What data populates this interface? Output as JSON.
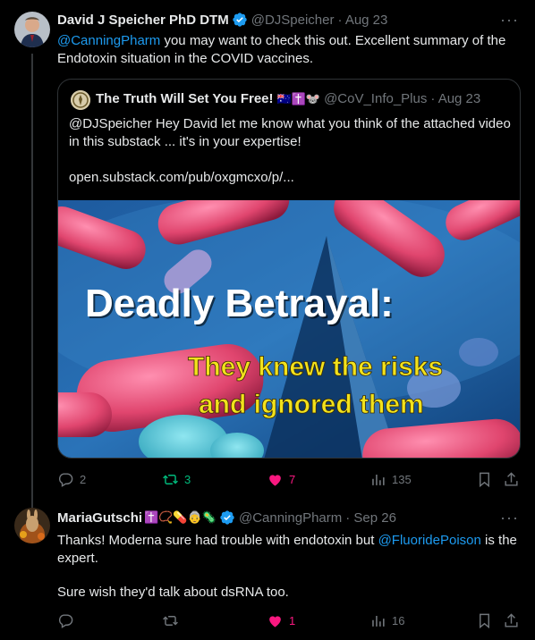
{
  "tweet1": {
    "name": "David J Speicher PhD DTM",
    "handle": "@DJSpeicher",
    "date": "· Aug 23",
    "more": "···",
    "mention": "@CanningPharm",
    "text_rest": " you may want to check this out.  Excellent summary of the Endotoxin situation in the COVID vaccines.",
    "quote": {
      "name": "The Truth Will Set You Free!",
      "emojis": "🇦🇺✝️🐭",
      "handle": "@CoV_Info_Plus",
      "date": "· Aug 23",
      "text": "@DJSpeicher Hey David let me know what you think of the attached video in this substack ... it's in your expertise!",
      "url": "open.substack.com/pub/oxgmcxo/p/...",
      "image_title": "Deadly Betrayal:",
      "image_sub1": "They knew the risks",
      "image_sub2": "and ignored them"
    },
    "actions": {
      "replies": "2",
      "retweets": "3",
      "likes": "7",
      "views": "135"
    },
    "colors": {
      "retweet": "#00ba7c",
      "like": "#f91880"
    }
  },
  "tweet2": {
    "name": "MariaGutschi",
    "emojis": "✝️📿💊👵🦠",
    "handle": "@CanningPharm",
    "date": "· Sep 26",
    "more": "···",
    "text_a": "Thanks! Moderna sure had trouble with endotoxin but ",
    "mention": "@FluoridePoison",
    "text_b": " is the expert.",
    "text2": "Sure wish they'd talk about dsRNA too.",
    "actions": {
      "replies": "",
      "retweets": "",
      "likes": "1",
      "views": "16"
    }
  },
  "colors": {
    "link": "#1d9bf0",
    "verified": "#1d9bf0",
    "muted": "#71767b",
    "background": "#000000"
  }
}
